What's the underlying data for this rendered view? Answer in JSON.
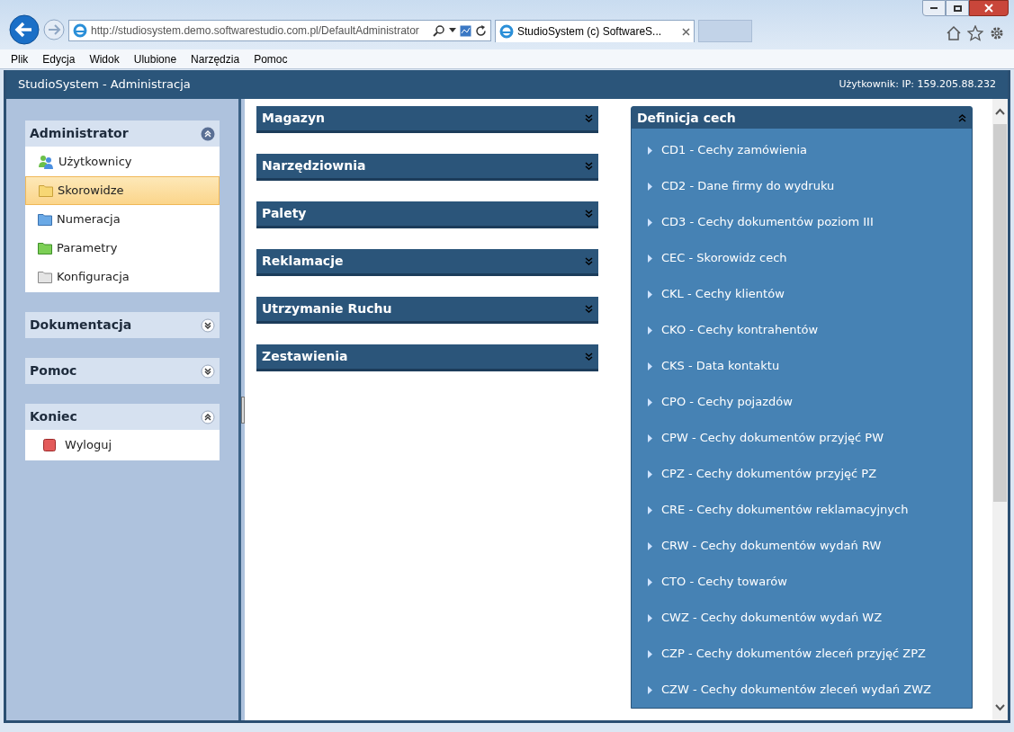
{
  "browser": {
    "address": "http://studiosystem.demo.softwarestudio.com.pl/DefaultAdministrator",
    "tabs": [
      {
        "label": "StudioSystem (c) SoftwareS...",
        "selected": true
      }
    ],
    "menu": [
      "Plik",
      "Edycja",
      "Widok",
      "Ulubione",
      "Narzędzia",
      "Pomoc"
    ]
  },
  "header": {
    "title": "StudioSystem - Administracja",
    "user": "Użytkownik: IP: 159.205.88.232"
  },
  "sidebar": [
    {
      "title": "Administrator",
      "expanded": true,
      "items": [
        {
          "label": "Użytkownicy",
          "kind": "users",
          "selected": false
        },
        {
          "label": "Skorowidze",
          "kind": "folder-yellow",
          "selected": true
        },
        {
          "label": "Numeracja",
          "kind": "folder-blue",
          "selected": false
        },
        {
          "label": "Parametry",
          "kind": "folder-green",
          "selected": false
        },
        {
          "label": "Konfiguracja",
          "kind": "folder-grey",
          "selected": false
        }
      ]
    },
    {
      "title": "Dokumentacja",
      "expanded": false
    },
    {
      "title": "Pomoc",
      "expanded": false
    },
    {
      "title": "Koniec",
      "expanded": true,
      "items": [
        {
          "label": "Wyloguj",
          "kind": "logout",
          "selected": false
        }
      ]
    }
  ],
  "panels": [
    {
      "title": "Magazyn",
      "expanded": false
    },
    {
      "title": "Narzędziownia",
      "expanded": false
    },
    {
      "title": "Palety",
      "expanded": false
    },
    {
      "title": "Reklamacje",
      "expanded": false
    },
    {
      "title": "Utrzymanie Ruchu",
      "expanded": false
    },
    {
      "title": "Zestawienia",
      "expanded": false
    }
  ],
  "definitions": {
    "title": "Definicja cech",
    "expanded": true,
    "items": [
      "CD1 - Cechy zamówienia",
      "CD2 - Dane firmy do wydruku",
      "CD3 - Cechy dokumentów poziom III",
      "CEC - Skorowidz cech",
      "CKL - Cechy klientów",
      "CKO - Cechy kontrahentów",
      "CKS - Data kontaktu",
      "CPO - Cechy pojazdów",
      "CPW - Cechy dokumentów przyjęć PW",
      "CPZ - Cechy dokumentów przyjęć PZ",
      "CRE - Cechy dokumentów reklamacyjnych",
      "CRW - Cechy dokumentów wydań RW",
      "CTO - Cechy towarów",
      "CWZ - Cechy dokumentów wydań WZ",
      "CZP - Cechy dokumentów zleceń przyjęć ZPZ",
      "CZW - Cechy dokumentów zleceń wydań ZWZ"
    ]
  }
}
